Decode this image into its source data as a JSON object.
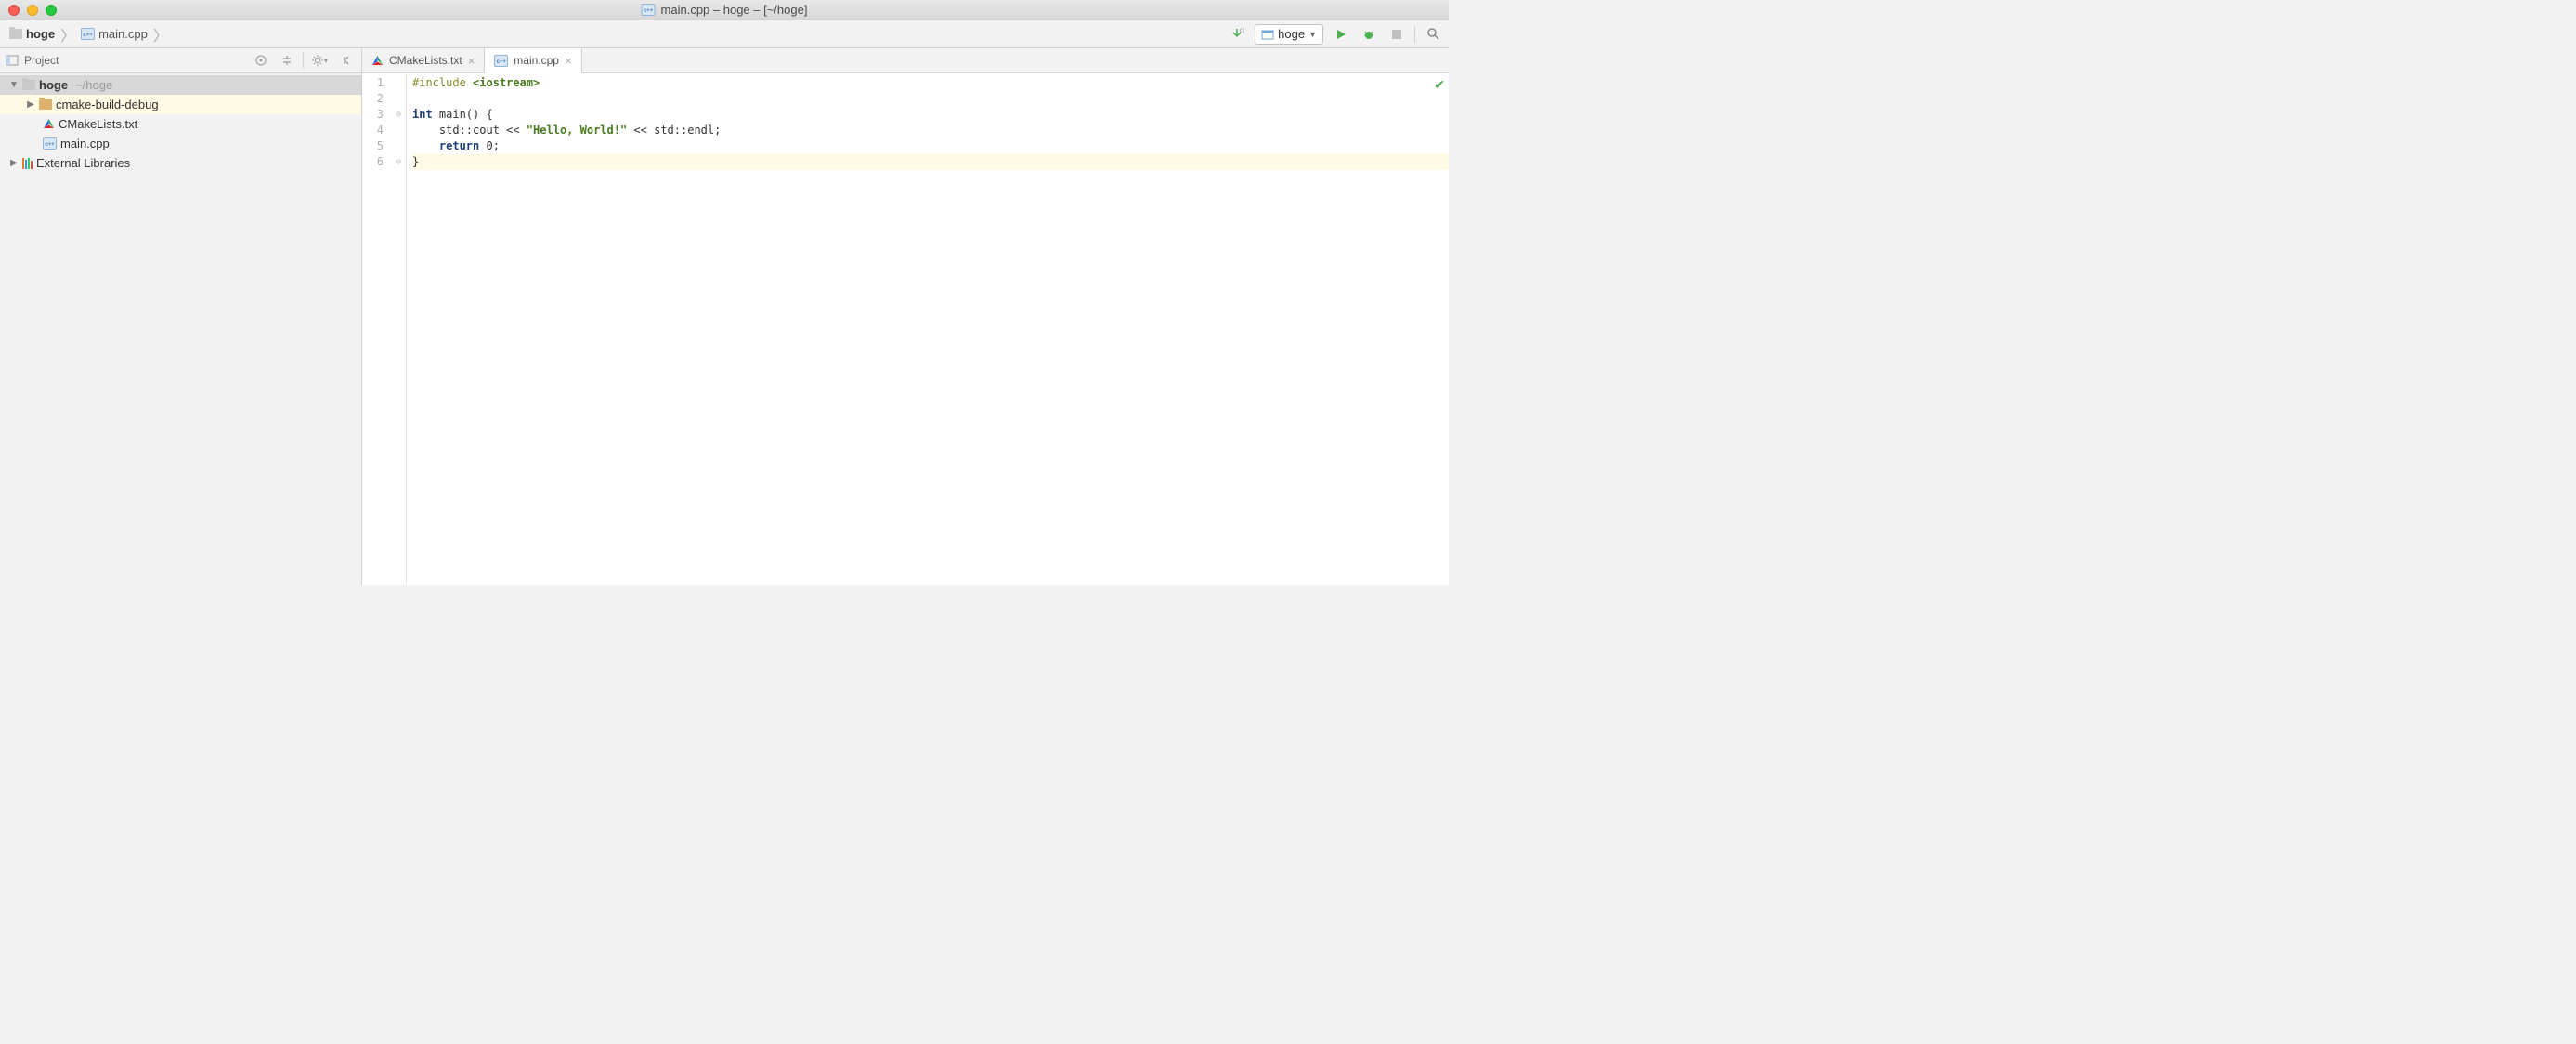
{
  "window": {
    "title": "main.cpp – hoge – [~/hoge]"
  },
  "breadcrumb": {
    "root": "hoge",
    "file": "main.cpp"
  },
  "toolbar": {
    "run_config": "hoge"
  },
  "sidebar": {
    "title": "Project",
    "root_name": "hoge",
    "root_path": "~/hoge",
    "items": [
      {
        "label": "cmake-build-debug",
        "icon": "folder"
      },
      {
        "label": "CMakeLists.txt",
        "icon": "cmake"
      },
      {
        "label": "main.cpp",
        "icon": "cpp"
      }
    ],
    "external": "External Libraries"
  },
  "tabs": [
    {
      "label": "CMakeLists.txt",
      "icon": "cmake",
      "active": false
    },
    {
      "label": "main.cpp",
      "icon": "cpp",
      "active": true
    }
  ],
  "editor": {
    "line_numbers": [
      "1",
      "2",
      "3",
      "4",
      "5",
      "6"
    ],
    "code": {
      "l1_pp": "#include ",
      "l1_inc": "<iostream>",
      "l3_kw": "int",
      "l3_rest": " main() {",
      "l4_indent": "    std::cout << ",
      "l4_str": "\"Hello, World!\"",
      "l4_mid": " << std::endl;",
      "l5_indent": "    ",
      "l5_kw": "return",
      "l5_rest": " 0;",
      "l6": "}"
    }
  }
}
